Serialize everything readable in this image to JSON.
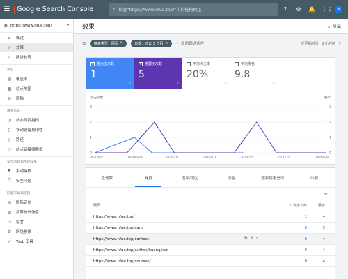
{
  "topbar": {
    "app_title": "Google Search Console",
    "search_placeholder": "检查“https://www.nfue.top/”中的任何网址",
    "avatar_letter": "N"
  },
  "sidebar": {
    "property": "https://www.nfue.top/",
    "items": [
      {
        "label": "概述",
        "icon": "home-icon",
        "glyph": "⌂"
      },
      {
        "label": "效果",
        "icon": "trending-up-icon",
        "glyph": "↗",
        "active": true
      },
      {
        "label": "网址检查",
        "icon": "search-icon",
        "glyph": "⌕"
      }
    ],
    "section_index": "索引",
    "index_items": [
      {
        "label": "覆盖率",
        "icon": "coverage-icon",
        "glyph": "▤"
      },
      {
        "label": "站点地图",
        "icon": "sitemap-icon",
        "glyph": "▦"
      },
      {
        "label": "删除",
        "icon": "removals-icon",
        "glyph": "⊘"
      }
    ],
    "section_enhance": "增强功能",
    "enhance_items": [
      {
        "label": "核心网页指标",
        "icon": "speed-icon",
        "glyph": "◔"
      },
      {
        "label": "移动设备易用性",
        "icon": "phone-icon",
        "glyph": "▯"
      },
      {
        "label": "路径",
        "icon": "breadcrumb-icon",
        "glyph": "◇"
      },
      {
        "label": "站点链接搜索框",
        "icon": "sitelinks-icon",
        "glyph": "◇"
      }
    ],
    "section_security": "安全问题和手动操作",
    "security_items": [
      {
        "label": "手动操作",
        "icon": "flag-icon",
        "glyph": "⚑"
      },
      {
        "label": "安全问题",
        "icon": "shield-icon",
        "glyph": "⛉"
      }
    ],
    "section_legacy": "旧版工具和报告",
    "legacy_items": [
      {
        "label": "国际定位",
        "icon": "globe-icon",
        "glyph": "◍"
      },
      {
        "label": "抓取统计信息",
        "icon": "chart-icon",
        "glyph": "▥"
      },
      {
        "label": "留言",
        "icon": "message-icon",
        "glyph": "▭"
      },
      {
        "label": "网址参数",
        "icon": "params-icon",
        "glyph": "⚙"
      },
      {
        "label": "Web 工具",
        "icon": "external-link-icon",
        "glyph": "↗"
      }
    ]
  },
  "header": {
    "title": "效果",
    "export_label": "导出"
  },
  "filters": {
    "chip1": "搜索类型：网页",
    "chip2": "日期：过去 3 个月",
    "add_filter": "新的筛选条件",
    "updated": "上次更新时间：3 小时前"
  },
  "metrics": [
    {
      "label": "总点击次数",
      "value": "1",
      "checked": true,
      "color": "#4285f4"
    },
    {
      "label": "总展示次数",
      "value": "5",
      "checked": true,
      "color": "#5e35b1"
    },
    {
      "label": "平均点击率",
      "value": "20%",
      "checked": false
    },
    {
      "label": "平均排名",
      "value": "9.8",
      "checked": false
    }
  ],
  "chart_data": {
    "type": "line",
    "ylabel_left": "点击次数",
    "ylabel_right": "展示",
    "left_ticks": [
      0,
      1,
      2,
      3
    ],
    "right_ticks": [
      0,
      1,
      2,
      3
    ],
    "ylim": [
      0,
      3
    ],
    "x_labels": [
      "2020/6/27",
      "2020/6/29",
      "2020/7/1",
      "2020/7/3",
      "2020/7/5",
      "2020/7/7",
      "2020/7/9"
    ],
    "grid": true,
    "series": [
      {
        "name": "总点击次数",
        "color": "#4285f4",
        "points": [
          [
            0,
            0
          ],
          [
            1.6,
            1
          ],
          [
            2.3,
            0
          ],
          [
            6,
            0
          ]
        ]
      },
      {
        "name": "总展示次数",
        "color": "#5e35b1",
        "points": [
          [
            0,
            0
          ],
          [
            1.3,
            0
          ],
          [
            2.4,
            2
          ],
          [
            3.2,
            0
          ],
          [
            5.6,
            0
          ],
          [
            6.5,
            2
          ],
          [
            7.3,
            0
          ],
          [
            9.3,
            0
          ]
        ]
      }
    ],
    "x_range": [
      0,
      9.3
    ]
  },
  "table": {
    "tabs": [
      "查询数",
      "网页",
      "国家/地区",
      "设备",
      "搜索结果呈现",
      "日期"
    ],
    "active_tab": 1,
    "col_page": "网页",
    "col_clicks": "点击次数",
    "col_impr": "展示",
    "rows": [
      {
        "page": "https://www.nfue.top/",
        "clicks": "1",
        "impr": "4"
      },
      {
        "page": "https://www.nfue.top/cart/",
        "clicks": "0",
        "impr": "5"
      },
      {
        "page": "https://www.nfue.top/contact",
        "clicks": "0",
        "impr": "4"
      },
      {
        "page": "https://www.nfue.top/author/huangjiexi",
        "clicks": "0",
        "impr": "4"
      },
      {
        "page": "https://www.nfue.top/courses/",
        "clicks": "0",
        "impr": "4"
      }
    ]
  }
}
